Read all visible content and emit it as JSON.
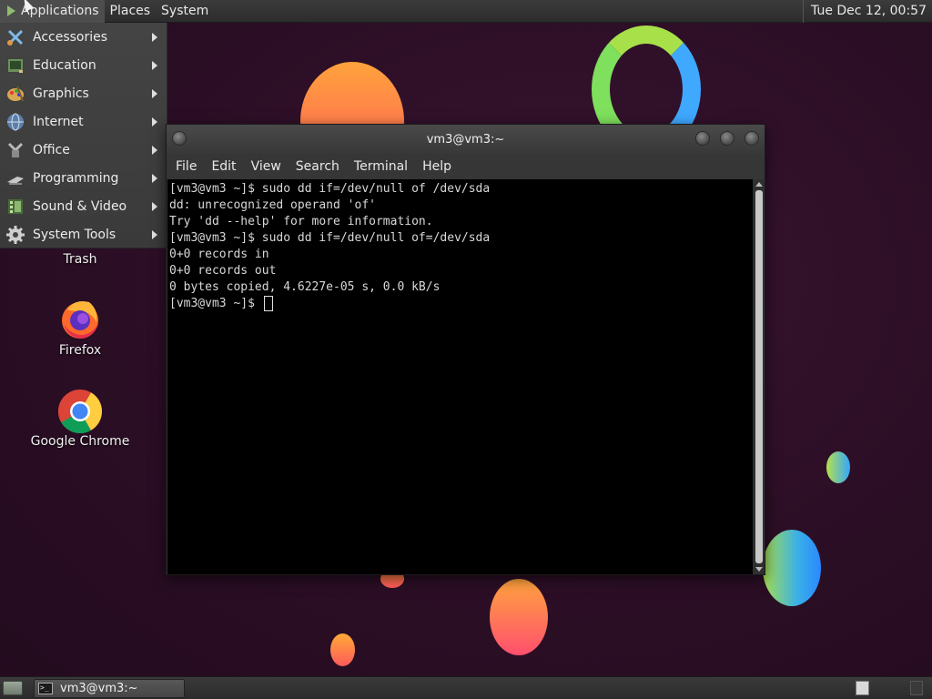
{
  "top_panel": {
    "menus": [
      "Applications",
      "Places",
      "System"
    ],
    "clock": "Tue Dec 12, 00:57"
  },
  "apps_menu": {
    "items": [
      {
        "label": "Accessories",
        "icon": "accessories-icon"
      },
      {
        "label": "Education",
        "icon": "education-icon"
      },
      {
        "label": "Graphics",
        "icon": "graphics-icon"
      },
      {
        "label": "Internet",
        "icon": "internet-icon"
      },
      {
        "label": "Office",
        "icon": "office-icon"
      },
      {
        "label": "Programming",
        "icon": "programming-icon"
      },
      {
        "label": "Sound & Video",
        "icon": "sound-video-icon"
      },
      {
        "label": "System Tools",
        "icon": "system-tools-icon"
      }
    ]
  },
  "desktop_icons": {
    "trash": "Trash",
    "firefox": "Firefox",
    "chrome": "Google Chrome"
  },
  "terminal": {
    "title": "vm3@vm3:~",
    "menu": [
      "File",
      "Edit",
      "View",
      "Search",
      "Terminal",
      "Help"
    ],
    "lines": [
      "[vm3@vm3 ~]$ sudo dd if=/dev/null of /dev/sda",
      "dd: unrecognized operand 'of'",
      "Try 'dd --help' for more information.",
      "[vm3@vm3 ~]$ sudo dd if=/dev/null of=/dev/sda",
      "0+0 records in",
      "0+0 records out",
      "0 bytes copied, 4.6227e-05 s, 0.0 kB/s",
      "[vm3@vm3 ~]$ "
    ]
  },
  "taskbar": {
    "task_label": "vm3@vm3:~"
  }
}
